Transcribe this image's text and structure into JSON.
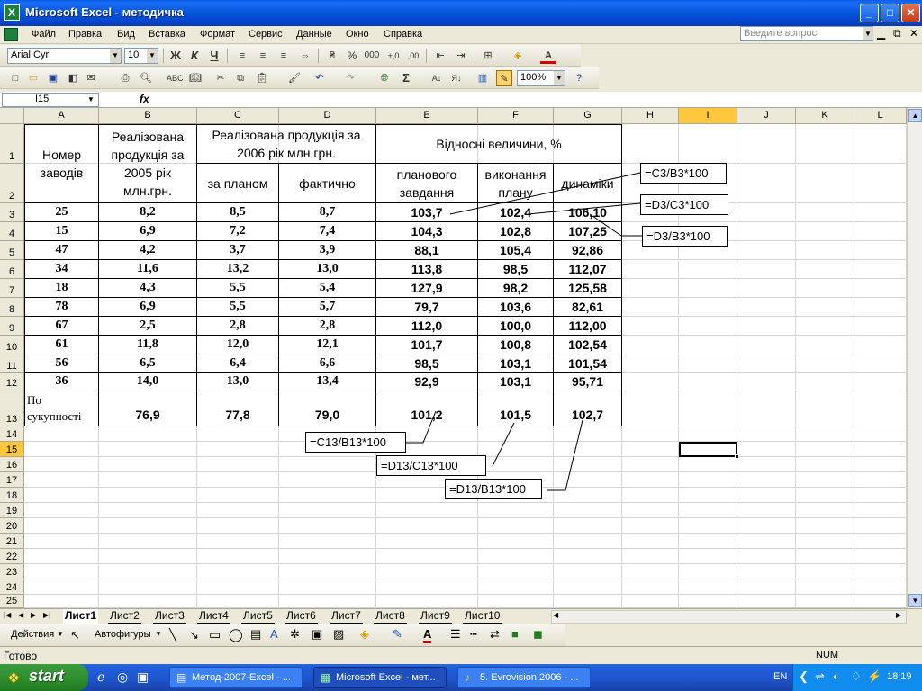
{
  "window": {
    "title": "Microsoft Excel - методичка",
    "min": "_",
    "max": "□",
    "close": "✕"
  },
  "menu": {
    "items": [
      "Файл",
      "Правка",
      "Вид",
      "Вставка",
      "Формат",
      "Сервис",
      "Данные",
      "Окно",
      "Справка"
    ],
    "question_placeholder": "Введите вопрос"
  },
  "toolbar": {
    "font": "Arial Cyr",
    "size": "10",
    "bold": "Ж",
    "italic": "К",
    "underline": "Ч",
    "percent": "%",
    "thousands": "000",
    "zoom": "100%"
  },
  "formula_bar": {
    "name_box": "I15",
    "fx": "fx",
    "formula": ""
  },
  "sheet": {
    "columns": [
      "A",
      "B",
      "C",
      "D",
      "E",
      "F",
      "G",
      "H",
      "I",
      "J",
      "K",
      "L"
    ],
    "rows": [
      "1",
      "2",
      "3",
      "4",
      "5",
      "6",
      "7",
      "8",
      "9",
      "10",
      "11",
      "12",
      "13",
      "14",
      "15",
      "16",
      "17",
      "18",
      "19",
      "20",
      "21",
      "22",
      "23",
      "24",
      "25"
    ],
    "active_cell": "I15",
    "header": {
      "a": "Номер заводів",
      "b": "Реалізована продукція за 2005 рік млн.грн.",
      "cd": "Реалізована продукція за 2006 рік млн.грн.",
      "c": "за планом",
      "d": "фактично",
      "efg": "Відносні величини, %",
      "e": "планового завдання",
      "f": "виконання плану",
      "g": "динаміки"
    },
    "data": [
      [
        "25",
        "8,2",
        "8,5",
        "8,7",
        "103,7",
        "102,4",
        "106,10"
      ],
      [
        "15",
        "6,9",
        "7,2",
        "7,4",
        "104,3",
        "102,8",
        "107,25"
      ],
      [
        "47",
        "4,2",
        "3,7",
        "3,9",
        "88,1",
        "105,4",
        "92,86"
      ],
      [
        "34",
        "11,6",
        "13,2",
        "13,0",
        "113,8",
        "98,5",
        "112,07"
      ],
      [
        "18",
        "4,3",
        "5,5",
        "5,4",
        "127,9",
        "98,2",
        "125,58"
      ],
      [
        "78",
        "6,9",
        "5,5",
        "5,7",
        "79,7",
        "103,6",
        "82,61"
      ],
      [
        "67",
        "2,5",
        "2,8",
        "2,8",
        "112,0",
        "100,0",
        "112,00"
      ],
      [
        "61",
        "11,8",
        "12,0",
        "12,1",
        "101,7",
        "100,8",
        "102,54"
      ],
      [
        "56",
        "6,5",
        "6,4",
        "6,6",
        "98,5",
        "103,1",
        "101,54"
      ],
      [
        "36",
        "14,0",
        "13,0",
        "13,4",
        "92,9",
        "103,1",
        "95,71"
      ]
    ],
    "total": {
      "label": "По сукупності",
      "values": [
        "76,9",
        "77,8",
        "79,0",
        "101,2",
        "101,5",
        "102,7"
      ]
    },
    "annotations": {
      "c3b3": "=C3/B3*100",
      "d3c3": "=D3/C3*100",
      "d3b3": "=D3/B3*100",
      "c13b13": "=C13/B13*100",
      "d13c13": "=D13/C13*100",
      "d13b13": "=D13/B13*100"
    }
  },
  "sheet_tabs": [
    "Лист1",
    "Лист2",
    "Лист3",
    "Лист4",
    "Лист5",
    "Лист6",
    "Лист7",
    "Лист8",
    "Лист9",
    "Лист10"
  ],
  "drawing_toolbar": {
    "actions": "Действия",
    "autoshapes": "Автофигуры"
  },
  "status": {
    "left": "Готово",
    "num": "NUM"
  },
  "taskbar": {
    "start": "start",
    "tasks": [
      "Метод-2007-Excel - ...",
      "Microsoft Excel - мет...",
      "5. Evrovision 2006 - ..."
    ],
    "lang": "EN",
    "clock": "18:19"
  },
  "colors": {
    "title_blue": "#0a5ce8",
    "selection": "#ffc73c",
    "taskbar": "#245edb",
    "start_green": "#2f8f2f"
  }
}
